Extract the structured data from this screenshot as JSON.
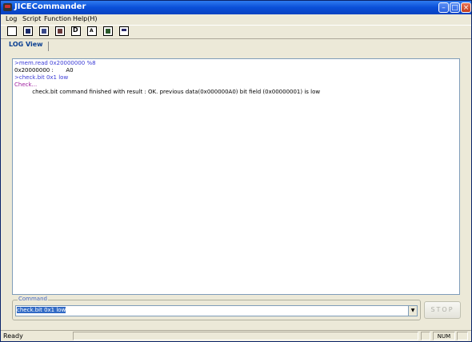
{
  "window": {
    "title": "JICECommander"
  },
  "menu": [
    "Log",
    "Script",
    "Function",
    "Help(H)"
  ],
  "toolbar": {
    "buttons": [
      {
        "name": "new-icon",
        "glyph": ""
      },
      {
        "name": "save-icon",
        "glyph": ""
      },
      {
        "name": "script-icon",
        "glyph": ""
      },
      {
        "name": "list-icon",
        "glyph": ""
      },
      {
        "name": "d-icon",
        "glyph": "D"
      },
      {
        "name": "a-icon",
        "glyph": "A"
      },
      {
        "name": "download-icon",
        "glyph": ""
      },
      {
        "name": "window-icon",
        "glyph": ""
      }
    ]
  },
  "tabs": {
    "log_view": "LOG View"
  },
  "log": [
    {
      "text": ">mem.read 0x20000000 %8",
      "color": "#3b3bd6"
    },
    {
      "text": "0x20000000 :       A0",
      "color": "#000000"
    },
    {
      "text": ">check.bit 0x1 low",
      "color": "#3b3bd6"
    },
    {
      "text": "Check...",
      "color": "#a020a0"
    },
    {
      "text": "          check.bit command finished with result : OK. previous data(0x000000A0) bit field (0x00000001) is low",
      "color": "#000000"
    }
  ],
  "command": {
    "label": "Command",
    "value": "check.bit 0x1 low"
  },
  "stop_button": "STOP",
  "status": {
    "main": "Ready",
    "num": "NUM"
  }
}
